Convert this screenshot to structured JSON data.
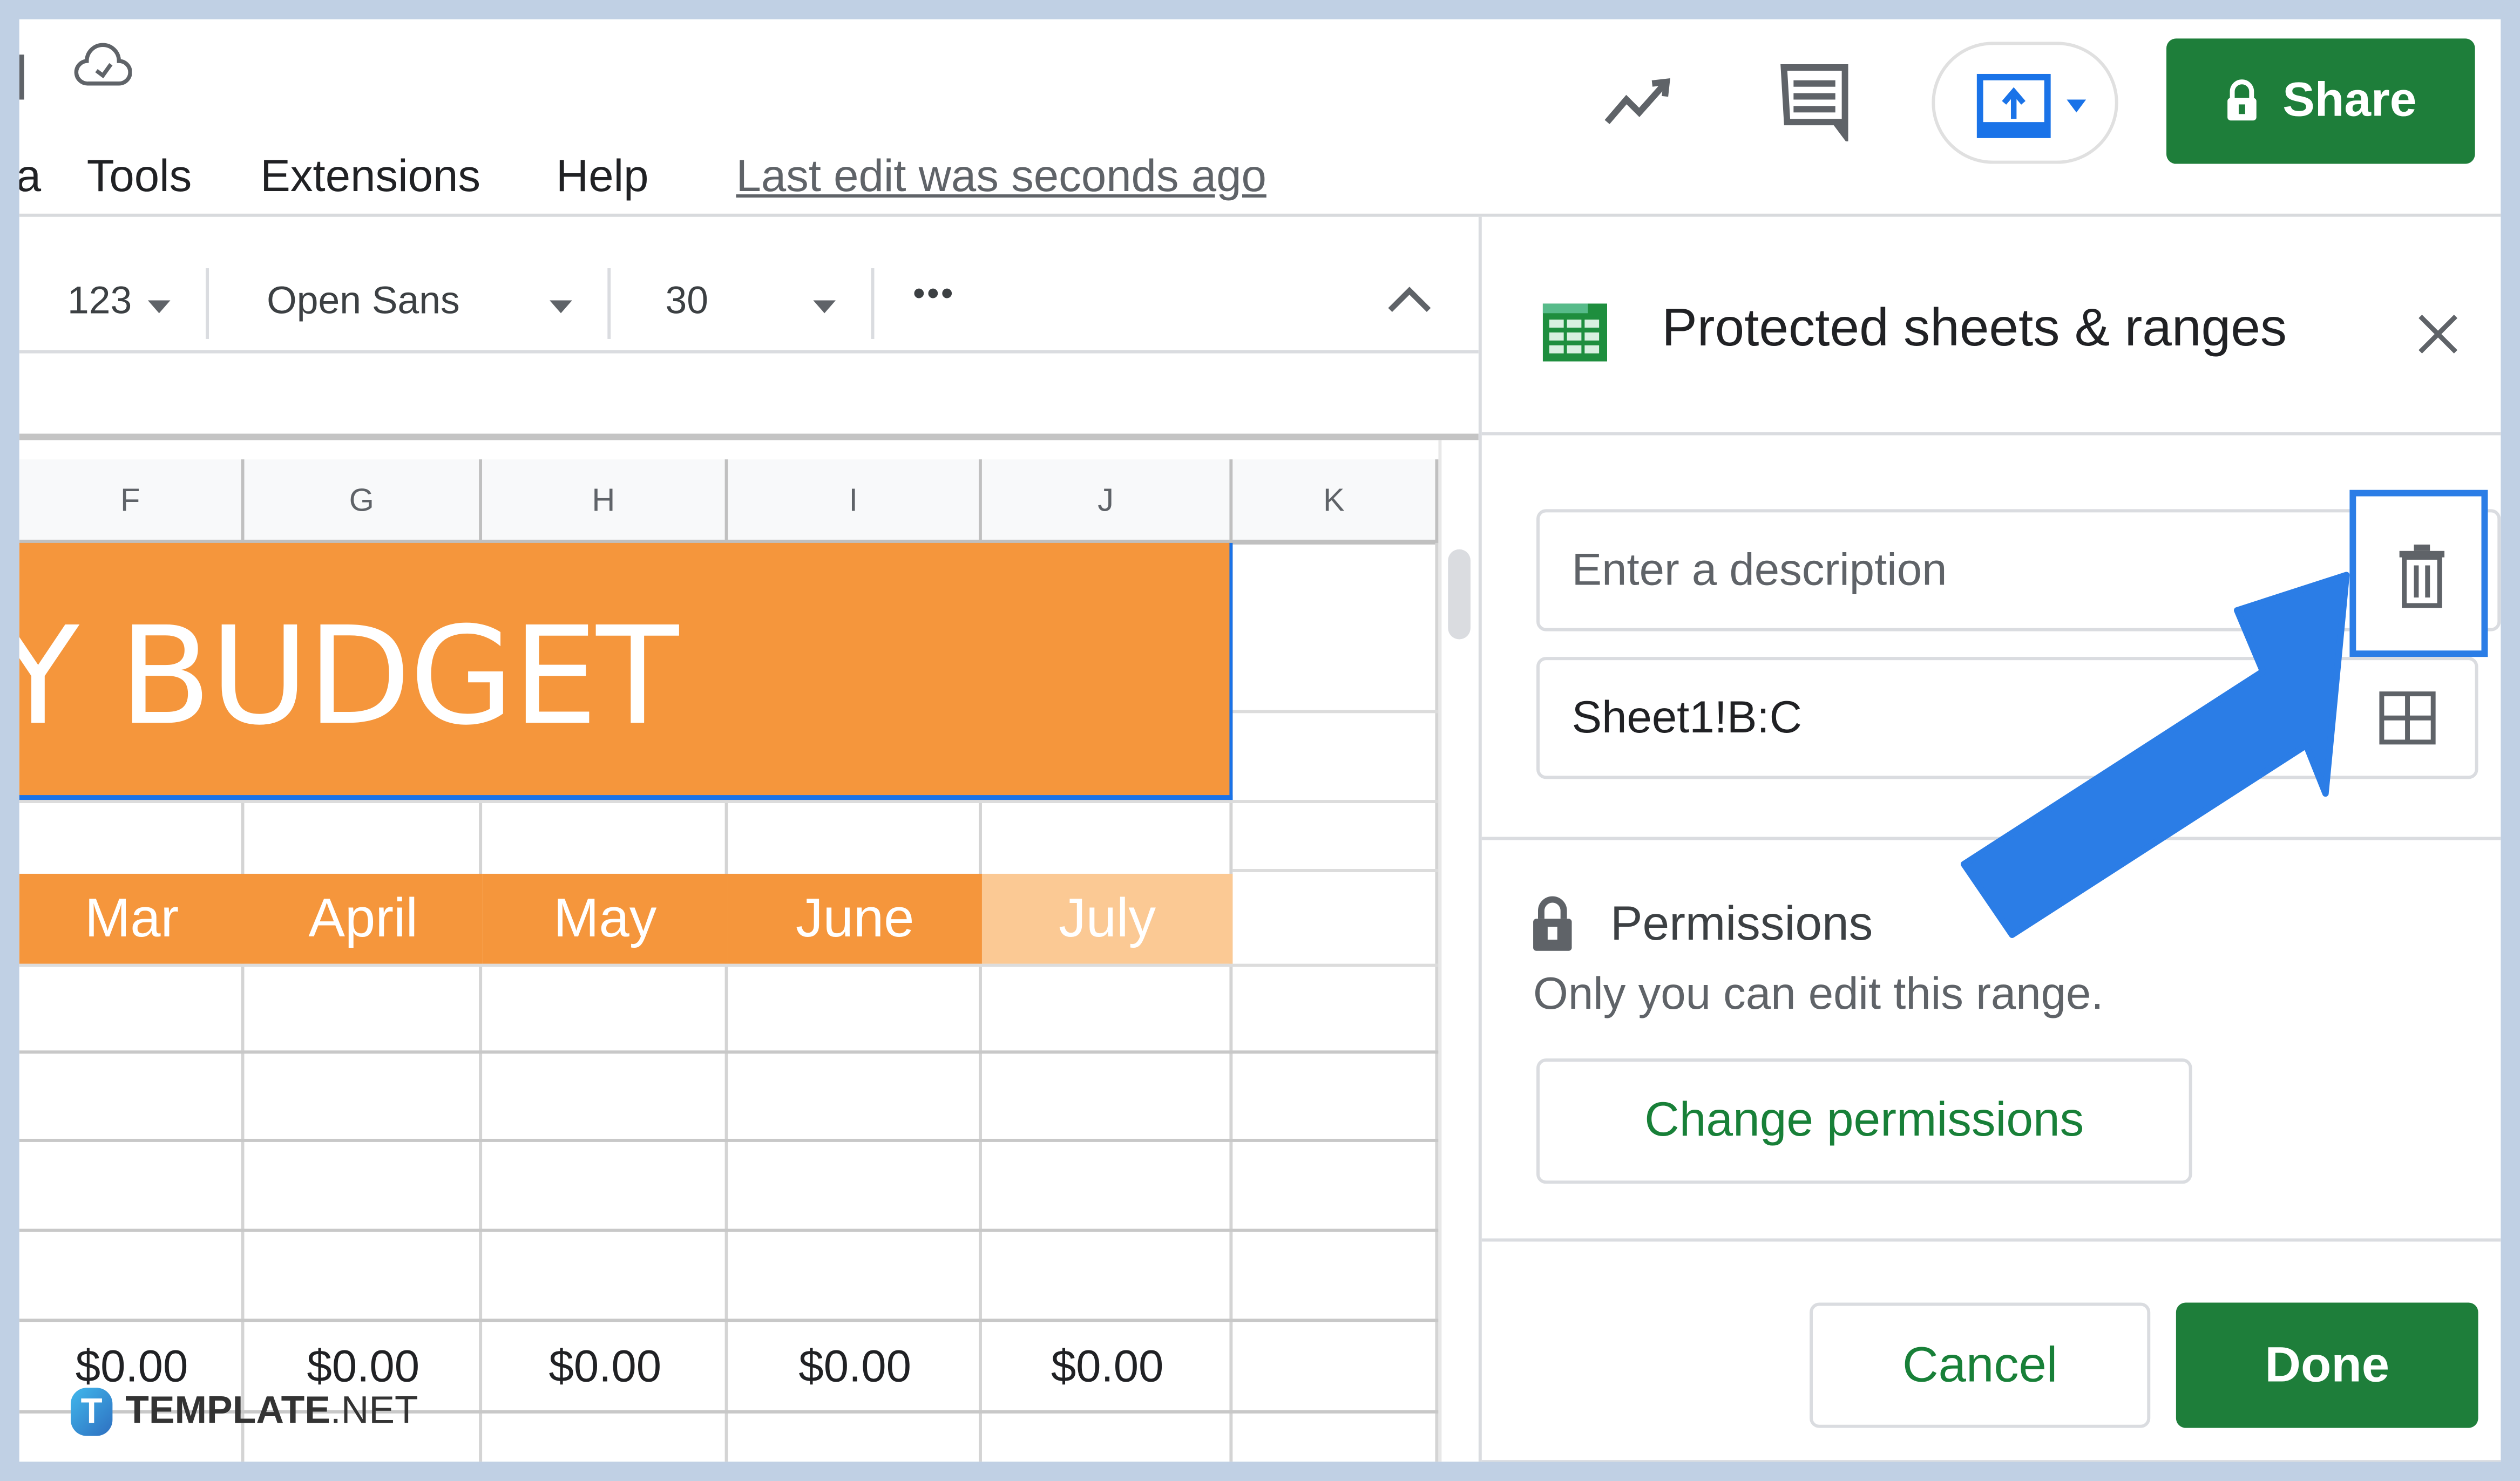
{
  "menu": {
    "partial_item": "a",
    "items": [
      "Tools",
      "Extensions",
      "Help"
    ],
    "last_edit": "Last edit was seconds ago"
  },
  "header": {
    "share_label": "Share",
    "icons": [
      "cloud-saved-icon",
      "trend-explore-icon",
      "comments-icon",
      "present-icon",
      "lock-icon"
    ]
  },
  "toolbar": {
    "number_format": "123",
    "font_family": "Open Sans",
    "font_size": "30",
    "more": "•••"
  },
  "sheet": {
    "columns": [
      "F",
      "G",
      "H",
      "I",
      "J",
      "K"
    ],
    "title_cell": "Y BUDGET",
    "months": [
      "Mar",
      "April",
      "May",
      "June",
      "July"
    ],
    "totals": [
      "$0.00",
      "$0.00",
      "$0.00",
      "$0.00",
      "$0.00"
    ],
    "colors": {
      "orange": "#f5963c",
      "light_orange": "#fbc994",
      "selection": "#1a73e8"
    }
  },
  "panel": {
    "title": "Protected sheets & ranges",
    "description_placeholder": "Enter a description",
    "range_value": "Sheet1!B:C",
    "permissions_heading": "Permissions",
    "permissions_text": "Only you can edit this range.",
    "change_permissions_label": "Change permissions",
    "cancel_label": "Cancel",
    "done_label": "Done",
    "colors": {
      "green": "#1e7e3a",
      "highlight": "#2b7de6"
    }
  },
  "watermark": {
    "brand_bold": "TEMPLATE",
    "brand_light": ".NET",
    "logo_letter": "T"
  }
}
